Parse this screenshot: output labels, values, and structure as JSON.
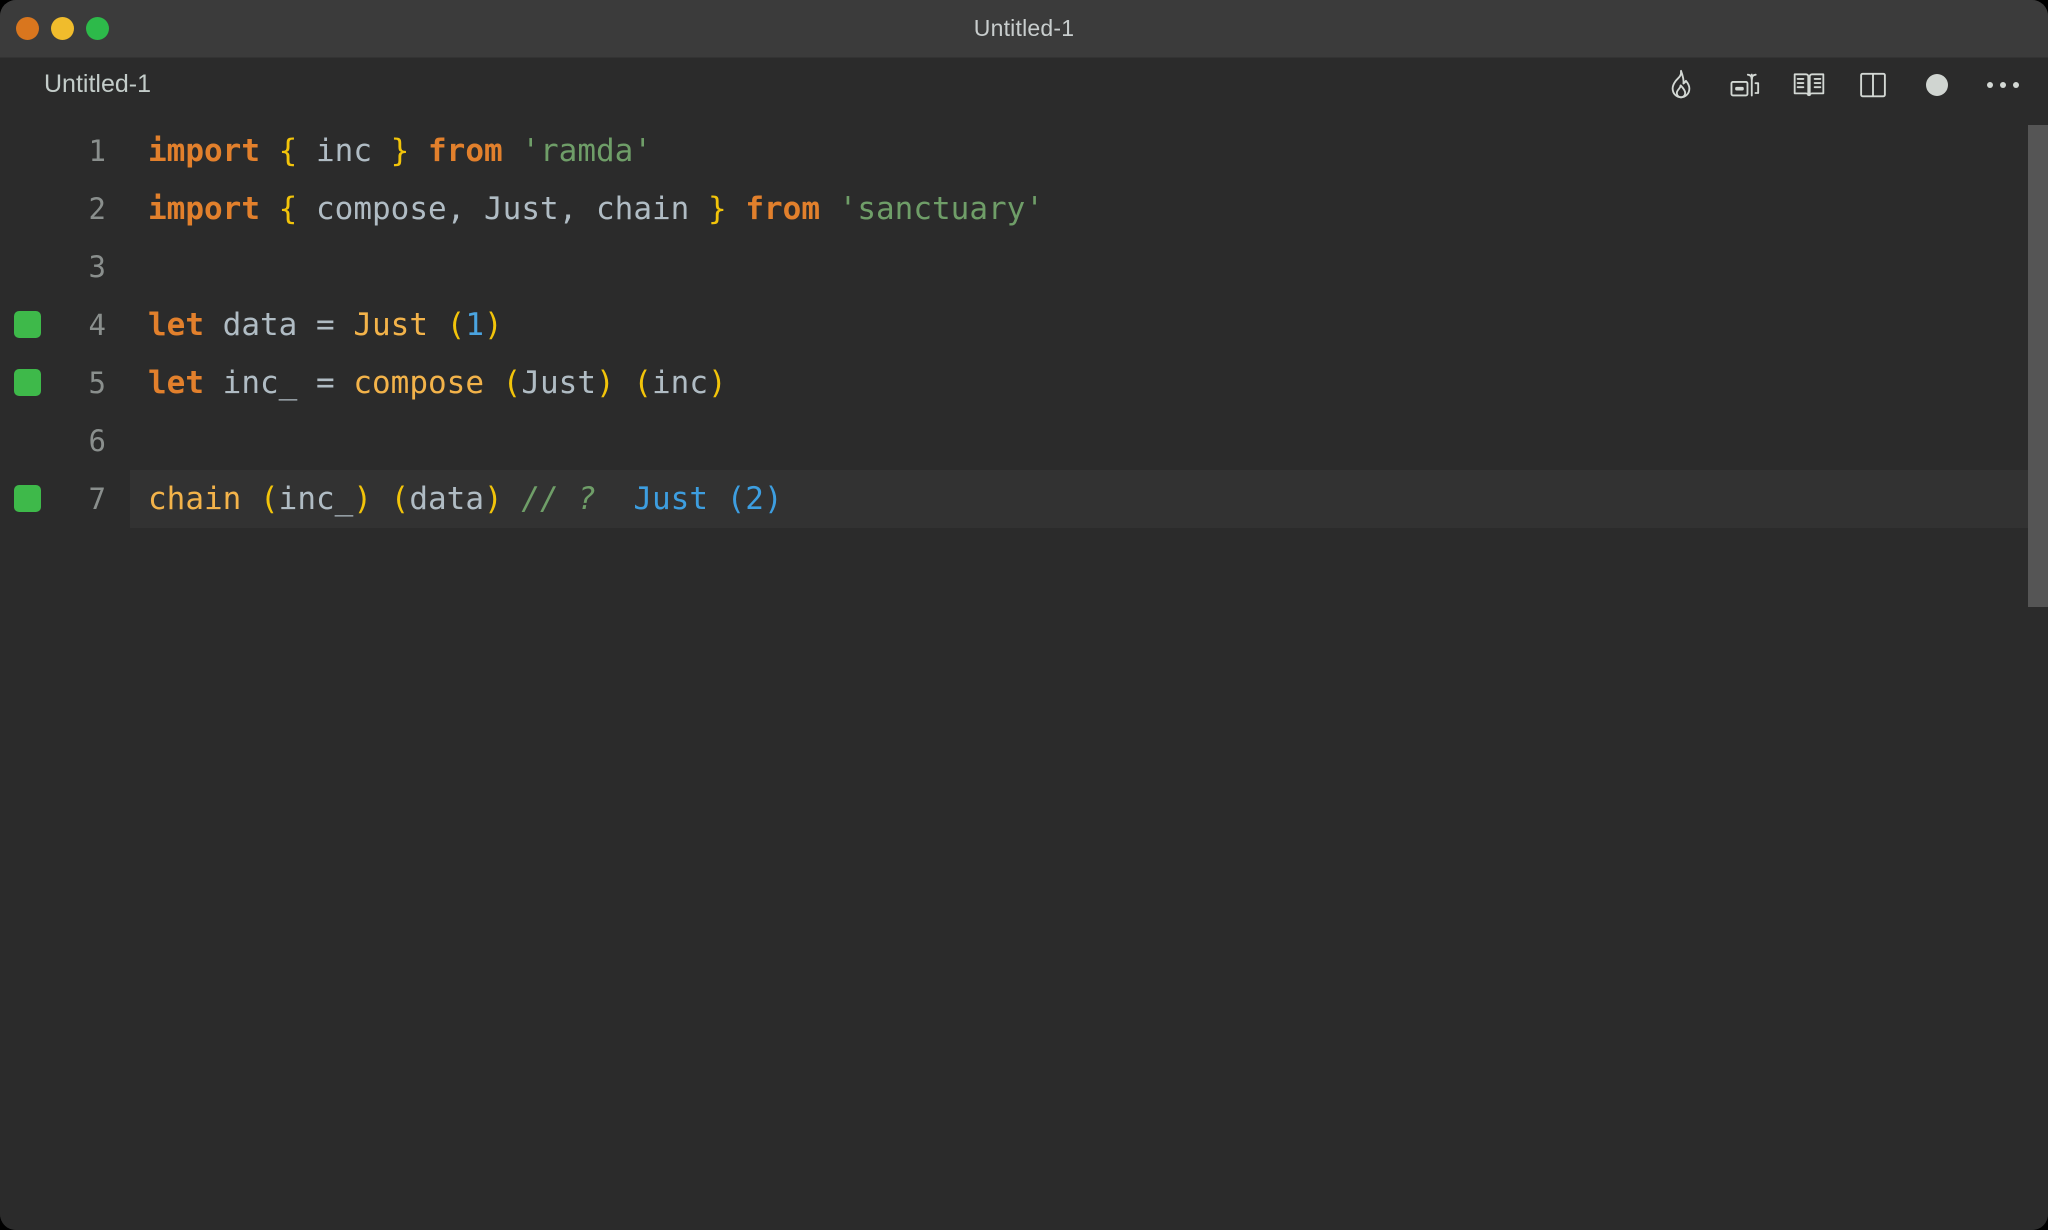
{
  "window": {
    "title": "Untitled-1",
    "traffic_lights": [
      {
        "name": "close",
        "color": "#d9761e"
      },
      {
        "name": "minimize",
        "color": "#f0bc2c"
      },
      {
        "name": "maximize",
        "color": "#2dba4a"
      }
    ]
  },
  "tabbar": {
    "tab_label": "Untitled-1",
    "toolbar_icons": [
      {
        "name": "flame-icon",
        "title": "Start Quokka"
      },
      {
        "name": "run-code-icon",
        "title": "Run Code"
      },
      {
        "name": "open-book-icon",
        "title": "Open Preview"
      },
      {
        "name": "split-editor-icon",
        "title": "Split Editor"
      },
      {
        "name": "dot-icon",
        "title": "Unsaved Changes"
      },
      {
        "name": "more-actions-icon",
        "title": "More Actions..."
      }
    ]
  },
  "editor": {
    "theme_colors": {
      "background": "#2b2b2b",
      "active_line": "#323232",
      "keyword": "#e2802c",
      "brace": "#f2c40a",
      "identifier": "#b0bcc4",
      "string": "#6f9e68",
      "function": "#f3b34a",
      "number": "#4ba4e0",
      "comment": "#6f9e68",
      "inline_result": "#3d9ee0",
      "gutter_marker": "#3eb94a",
      "line_number": "#8a8f8d",
      "scrollbar": "#555555"
    },
    "lines": [
      {
        "number": "1",
        "marker": false,
        "active": false,
        "text": "import { inc } from 'ramda'",
        "tokens": [
          {
            "t": "import",
            "c": "kw"
          },
          {
            "t": " ",
            "c": "id"
          },
          {
            "t": "{",
            "c": "brace"
          },
          {
            "t": " ",
            "c": "id"
          },
          {
            "t": "inc",
            "c": "id"
          },
          {
            "t": " ",
            "c": "id"
          },
          {
            "t": "}",
            "c": "brace"
          },
          {
            "t": " ",
            "c": "id"
          },
          {
            "t": "from",
            "c": "kw"
          },
          {
            "t": " ",
            "c": "id"
          },
          {
            "t": "'ramda'",
            "c": "str"
          }
        ]
      },
      {
        "number": "2",
        "marker": false,
        "active": false,
        "text": "import { compose, Just, chain } from 'sanctuary'",
        "tokens": [
          {
            "t": "import",
            "c": "kw"
          },
          {
            "t": " ",
            "c": "id"
          },
          {
            "t": "{",
            "c": "brace"
          },
          {
            "t": " ",
            "c": "id"
          },
          {
            "t": "compose",
            "c": "id"
          },
          {
            "t": ",",
            "c": "punc"
          },
          {
            "t": " ",
            "c": "id"
          },
          {
            "t": "Just",
            "c": "id"
          },
          {
            "t": ",",
            "c": "punc"
          },
          {
            "t": " ",
            "c": "id"
          },
          {
            "t": "chain",
            "c": "id"
          },
          {
            "t": " ",
            "c": "id"
          },
          {
            "t": "}",
            "c": "brace"
          },
          {
            "t": " ",
            "c": "id"
          },
          {
            "t": "from",
            "c": "kw"
          },
          {
            "t": " ",
            "c": "id"
          },
          {
            "t": "'sanctuary'",
            "c": "str"
          }
        ]
      },
      {
        "number": "3",
        "marker": false,
        "active": false,
        "text": "",
        "tokens": []
      },
      {
        "number": "4",
        "marker": true,
        "active": false,
        "text": "let data = Just (1)",
        "tokens": [
          {
            "t": "let",
            "c": "kw"
          },
          {
            "t": " ",
            "c": "id"
          },
          {
            "t": "data",
            "c": "id"
          },
          {
            "t": " ",
            "c": "id"
          },
          {
            "t": "=",
            "c": "op"
          },
          {
            "t": " ",
            "c": "id"
          },
          {
            "t": "Just",
            "c": "fn"
          },
          {
            "t": " ",
            "c": "id"
          },
          {
            "t": "(",
            "c": "paren"
          },
          {
            "t": "1",
            "c": "num"
          },
          {
            "t": ")",
            "c": "paren"
          }
        ]
      },
      {
        "number": "5",
        "marker": true,
        "active": false,
        "text": "let inc_ = compose (Just) (inc)",
        "tokens": [
          {
            "t": "let",
            "c": "kw"
          },
          {
            "t": " ",
            "c": "id"
          },
          {
            "t": "inc_",
            "c": "id"
          },
          {
            "t": " ",
            "c": "id"
          },
          {
            "t": "=",
            "c": "op"
          },
          {
            "t": " ",
            "c": "id"
          },
          {
            "t": "compose",
            "c": "fn"
          },
          {
            "t": " ",
            "c": "id"
          },
          {
            "t": "(",
            "c": "paren"
          },
          {
            "t": "Just",
            "c": "id"
          },
          {
            "t": ")",
            "c": "paren"
          },
          {
            "t": " ",
            "c": "id"
          },
          {
            "t": "(",
            "c": "paren"
          },
          {
            "t": "inc",
            "c": "id"
          },
          {
            "t": ")",
            "c": "paren"
          }
        ]
      },
      {
        "number": "6",
        "marker": false,
        "active": false,
        "text": "",
        "tokens": []
      },
      {
        "number": "7",
        "marker": true,
        "active": true,
        "text": "chain (inc_) (data) // ?  Just (2)",
        "tokens": [
          {
            "t": "chain",
            "c": "fn"
          },
          {
            "t": " ",
            "c": "id"
          },
          {
            "t": "(",
            "c": "paren"
          },
          {
            "t": "inc_",
            "c": "id"
          },
          {
            "t": ")",
            "c": "paren"
          },
          {
            "t": " ",
            "c": "id"
          },
          {
            "t": "(",
            "c": "paren"
          },
          {
            "t": "data",
            "c": "id"
          },
          {
            "t": ")",
            "c": "paren"
          },
          {
            "t": " ",
            "c": "id"
          },
          {
            "t": "// ?",
            "c": "comment"
          },
          {
            "t": "  ",
            "c": "id"
          },
          {
            "t": "Just (2)",
            "c": "result"
          }
        ]
      }
    ]
  }
}
